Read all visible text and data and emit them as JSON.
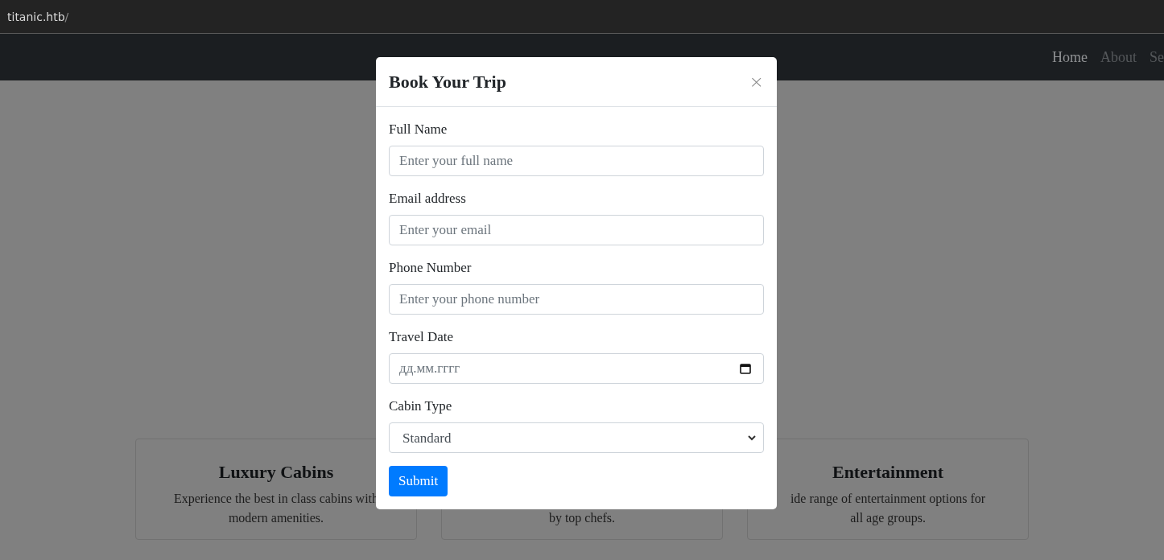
{
  "address_bar": {
    "host": "titanic.htb",
    "path": "/"
  },
  "navbar": {
    "items": [
      {
        "label": "Home",
        "selected": true
      },
      {
        "label": "About",
        "selected": false
      },
      {
        "label": "Se",
        "selected": false
      }
    ]
  },
  "cards": [
    {
      "title": "Luxury Cabins",
      "lines": [
        "Experience the best in class cabins with",
        "modern amenities."
      ]
    },
    {
      "lines": [
        "by top chefs."
      ]
    },
    {
      "title": "Entertainment",
      "lines": [
        "ide range of entertainment options for",
        "all age groups."
      ]
    }
  ],
  "modal": {
    "title": "Book Your Trip",
    "close": "×",
    "fields": [
      {
        "kind": "text",
        "label": "Full Name",
        "placeholder": "Enter your full name"
      },
      {
        "kind": "text",
        "label": "Email address",
        "placeholder": "Enter your email"
      },
      {
        "kind": "text",
        "label": "Phone Number",
        "placeholder": "Enter your phone number"
      },
      {
        "kind": "date",
        "label": "Travel Date",
        "placeholder": "дд.мм.гггг"
      },
      {
        "kind": "select",
        "label": "Cabin Type",
        "value": "Standard"
      }
    ],
    "submit": "Submit"
  }
}
